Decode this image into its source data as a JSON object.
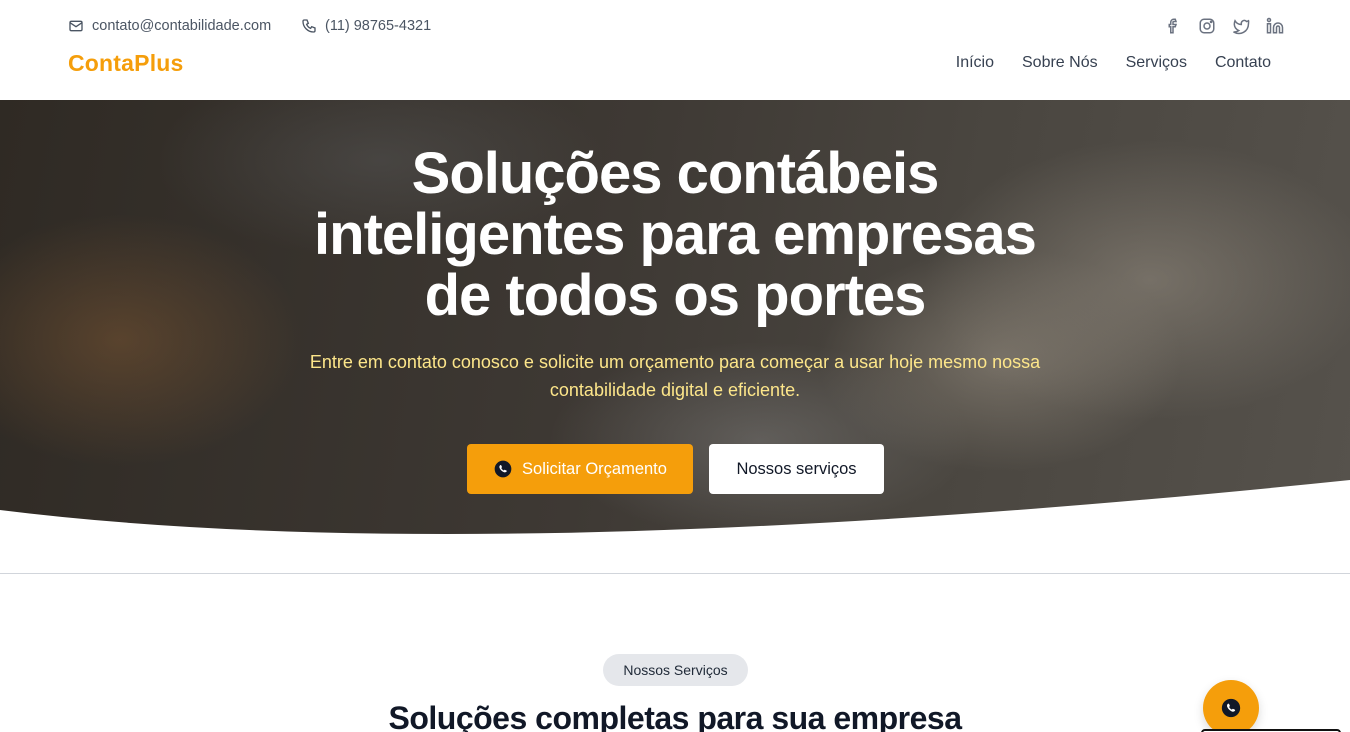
{
  "header": {
    "email": "contato@contabilidade.com",
    "phone": "(11) 98765-4321",
    "logo": "ContaPlus",
    "nav": [
      "Início",
      "Sobre Nós",
      "Serviços",
      "Contato"
    ],
    "socials": [
      "facebook-icon",
      "instagram-icon",
      "twitter-icon",
      "linkedin-icon"
    ]
  },
  "hero": {
    "title": "Soluções contábeis inteligentes para empresas de todos os portes",
    "subtitle": "Entre em contato conosco e solicite um orçamento para começar a usar hoje mesmo nossa contabilidade digital e eficiente.",
    "primary_button": "Solicitar Orçamento",
    "secondary_button": "Nossos serviços"
  },
  "services": {
    "badge": "Nossos Serviços",
    "title": "Soluções completas para sua empresa"
  },
  "colors": {
    "accent": "#f59e0b",
    "subtitle": "#fde68a",
    "text_dark": "#111827"
  }
}
